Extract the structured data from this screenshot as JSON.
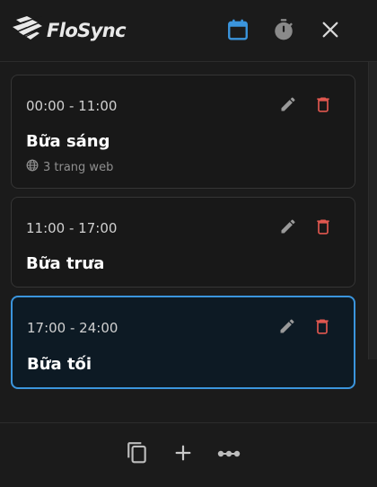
{
  "app": {
    "title": "FloSync"
  },
  "header": {
    "icons": [
      "calendar-icon",
      "timer-icon",
      "close-icon"
    ]
  },
  "schedules": [
    {
      "time": "00:00 - 11:00",
      "title": "Bữa sáng",
      "sites": "3 trang web",
      "selected": false
    },
    {
      "time": "11:00 - 17:00",
      "title": "Bữa trưa",
      "selected": false
    },
    {
      "time": "17:00 - 24:00",
      "title": "Bữa tối",
      "selected": true
    }
  ],
  "footer": {
    "icons": [
      "copy-icon",
      "add-icon",
      "more-icon"
    ]
  },
  "colors": {
    "accent": "#3b95dd",
    "delete": "#e0574f",
    "background": "#1b1b1b",
    "card": "#181818",
    "selected_card": "#0d1a24"
  }
}
